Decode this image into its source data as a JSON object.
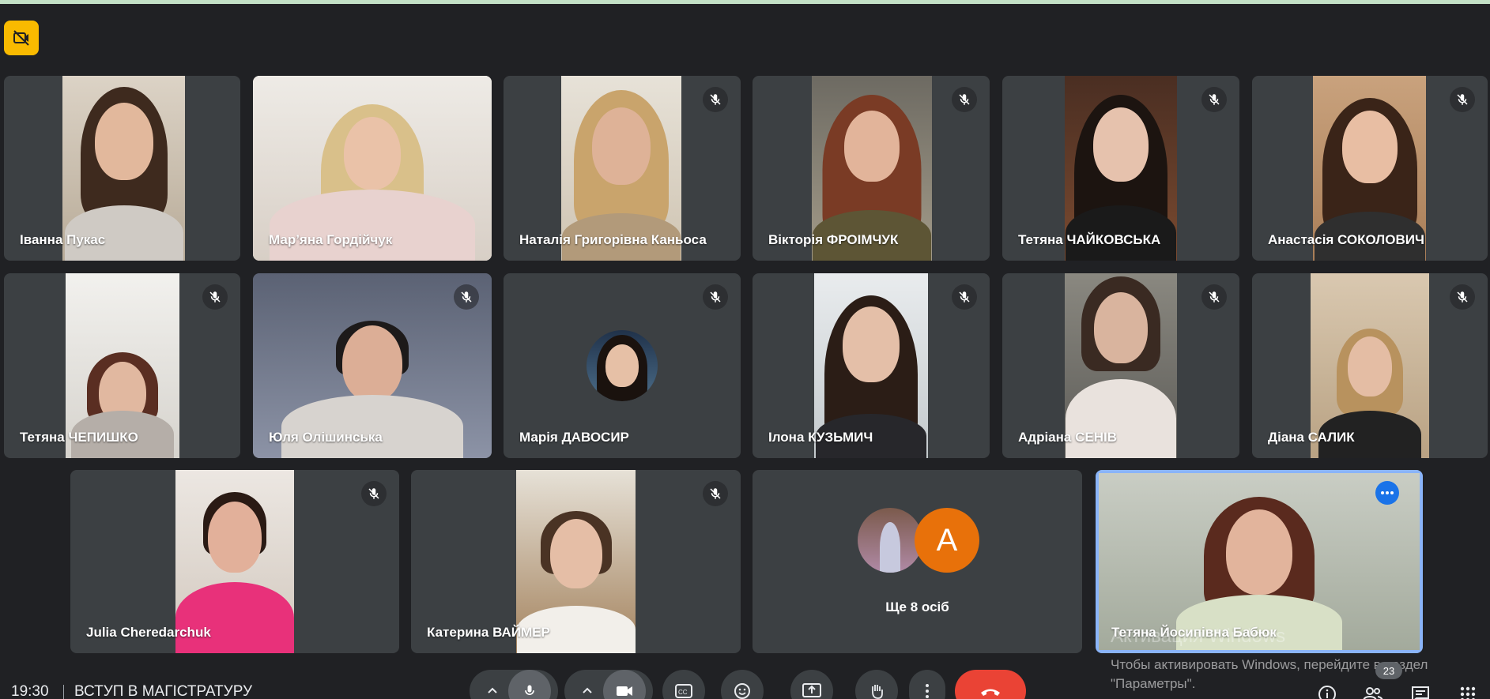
{
  "meeting": {
    "time": "19:30",
    "title": "ВСТУП В МАГІСТРАТУРУ",
    "participant_count": "23"
  },
  "participants": [
    {
      "name": "Іванна Пукас",
      "muted": false
    },
    {
      "name": "Мар’яна Гордійчук",
      "muted": false
    },
    {
      "name": "Наталія Григорівна Каньоса",
      "muted": true
    },
    {
      "name": "Вікторія ФРОІМЧУК",
      "muted": true
    },
    {
      "name": "Тетяна ЧАЙКОВСЬКА",
      "muted": true
    },
    {
      "name": "Анастасія СОКОЛОВИЧ",
      "muted": true
    },
    {
      "name": "Тетяна ЧЕПИШКО",
      "muted": true
    },
    {
      "name": "Юля Олішинська",
      "muted": true
    },
    {
      "name": "Марія ДАВОСИР",
      "muted": true
    },
    {
      "name": "Ілона КУЗЬМИЧ",
      "muted": true
    },
    {
      "name": "Адріана СЕНІВ",
      "muted": true
    },
    {
      "name": "Діана САЛИК",
      "muted": true
    },
    {
      "name": "Julia Cheredarchuk",
      "muted": true
    },
    {
      "name": "Катерина ВАЙМЕР",
      "muted": true
    },
    {
      "name": "Тетяна Йосипівна Бабюк",
      "muted": false
    }
  ],
  "others": {
    "label": "Ще 8 осіб",
    "avatar_letter": "A"
  },
  "watermark": {
    "title": "Активация Windows",
    "line1": "Чтобы активировать Windows, перейдите в раздел",
    "line2": "\"Параметры\"."
  },
  "colors": {
    "background": "#202124",
    "tile": "#3c4043",
    "accent": "#8ab4f8",
    "end_call": "#ea4335",
    "avatar_orange": "#e8710a",
    "badge_yellow": "#f9ba00"
  },
  "icons": {
    "top_left": "no-video-badge-icon",
    "mute": "mic-off-icon",
    "more": "more-options-icon",
    "controls": [
      "chevron-up-icon",
      "mic-icon",
      "chevron-up-icon",
      "camera-icon",
      "captions-icon",
      "emoji-icon",
      "present-icon",
      "raise-hand-icon",
      "more-vert-icon",
      "end-call-icon"
    ],
    "right": [
      "info-icon",
      "people-icon",
      "chat-icon",
      "apps-icon"
    ]
  }
}
